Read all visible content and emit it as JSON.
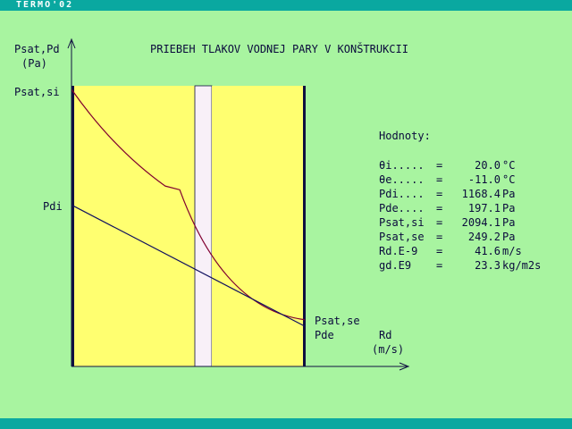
{
  "window": {
    "title": "TERMO'02"
  },
  "chart_data": {
    "type": "line",
    "title": "PRIEBEH TLAKOV VODNEJ PARY V KONŠTRUKCII",
    "ylabel": "Psat,Pd",
    "ylabel_unit": "(Pa)",
    "xlabel": "Rd",
    "xlabel_unit": "(m/s)",
    "labels": {
      "psat_si": "Psat,si",
      "pdi": "Pdi",
      "psat_se": "Psat,se",
      "pde": "Pde"
    },
    "layers": [
      {
        "fill": "#ffff70"
      },
      {
        "fill": "#f8f0f8"
      },
      {
        "fill": "#ffff70"
      }
    ],
    "series": [
      {
        "color": "#800030",
        "x": [
          0,
          16.7,
          19.3,
          41.6
        ],
        "y": [
          2094.1,
          1320,
          1290,
          249.2
        ]
      },
      {
        "color": "#101060",
        "x": [
          0,
          41.6
        ],
        "y": [
          1168.4,
          197.1
        ]
      }
    ]
  },
  "values_panel": {
    "heading": "Hodnoty:",
    "rows": [
      {
        "key": "θi.....",
        "eq": "=",
        "val": "20.0",
        "unit": "°C"
      },
      {
        "key": "θe.....",
        "eq": "=",
        "val": "-11.0",
        "unit": "°C"
      },
      {
        "key": "Pdi....",
        "eq": "=",
        "val": "1168.4",
        "unit": "Pa"
      },
      {
        "key": "Pde....",
        "eq": "=",
        "val": "197.1",
        "unit": "Pa"
      },
      {
        "key": "Psat,si",
        "eq": "=",
        "val": "2094.1",
        "unit": "Pa"
      },
      {
        "key": "Psat,se",
        "eq": "=",
        "val": "249.2",
        "unit": "Pa"
      },
      {
        "key": "Rd.E-9",
        "eq": "=",
        "val": "41.6",
        "unit": "m/s"
      },
      {
        "key": "gd.E9",
        "eq": "=",
        "val": "23.3",
        "unit": "kg/m2s"
      }
    ]
  }
}
